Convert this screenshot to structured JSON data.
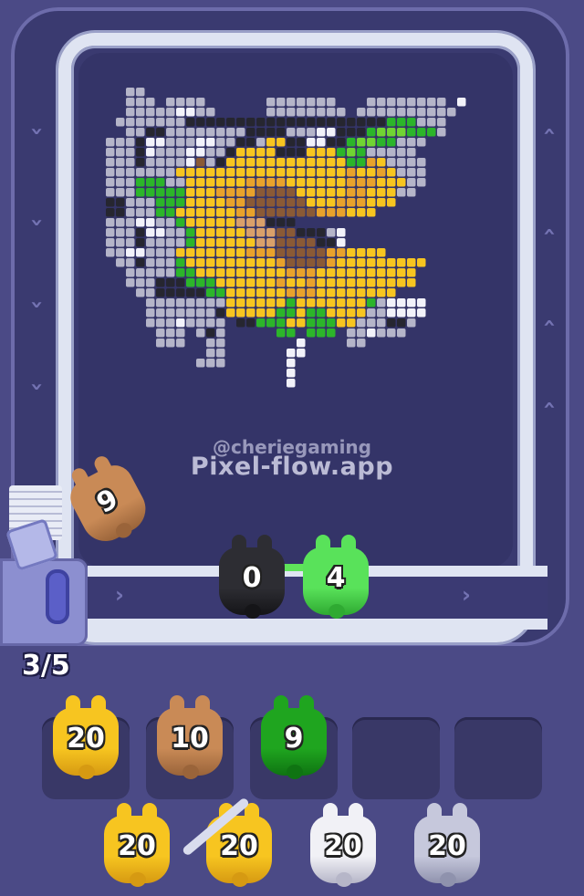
{
  "watermark": {
    "handle": "@cheriegaming",
    "site": "Pixel-flow.app"
  },
  "pixel_art": {
    "subject": "sunflower",
    "palette": {
      "W": "#f2f2fa",
      "G": "#b5b5c9",
      "D": "#262630",
      "Y": "#f7c520",
      "O": "#e8a22c",
      "B": "#8a5a36",
      "L": "#d9a06a",
      "V": "#2cb52a",
      "N": "#70d433"
    },
    "rows": [
      "..GG..............................",
      "..GGG.GGGG......GGGGGGG...GGGGGGGG.W",
      "..GGGGGWWGG.....GGGGGGGG.GGGGGGGGGG",
      ".GGGGGGGDDDDDDDDDDDDDDDDDDDDVVVGGG.",
      "..GGDDGGGGGGGGDDDDGGGWWDDDVNNNVVVG.",
      "GGGDWWGGGWWGGDDGYYDDWWDDVNNVVGGG.",
      "GGGDWGGGWWGGDYYYYDDDYYYVNVGGGGG..",
      "GGGDGGGGWBGDYYYYYYYYYYYYVVOYGGGG.",
      "GGGGGGGYYYYYYYYYYYYYYYYYOYYOYGGG",
      "GGGVVVGGYYYYYYOOOOYYYYYYOOOYYYGG",
      "GGGVVVVVYYYOOOOBBBBYYYYYOOYYYGG.",
      "DDGGGVVVYYYYOOBBBBBBYYYOOOYYY...",
      "DDGGGVVYYYYYYOOBBBBBBOOOYYY.....",
      "GGGWWGGVYYYYYLLLDDD.............",
      "GGGDWWGGVYYYYYLLLBBDDDGW........",
      "GGGDGGGGVYYYYYYLLBBBBDDW........",
      "GGWWGGGYYYYYYYOOOBBBBBOOYYYY....",
      ".GGDGGGVYYYYYYYYYOBBBBOYYYYYYYYY.",
      "..GGGGGVVYYYYYYYYYOOOYYYYYYYYYY..",
      "..GGGDDDVVVYYYYYYOYYOYYYYYYYYYY..",
      "...GGDDDDDVVYYYYYYOOOYYYYYYYY....",
      "....GGGGGGGGYYYYYYVYYYYYYYVGWWWW",
      "....GGGGGGGDYYYYYVVYVVYYYYGGWWWW",
      "....GGGWGGGG.DDVVVYYVVVYYGGGDDG.",
      ".....GGG.GDG.....VV.VVV.GGWGGG..",
      ".....GGG..GG.......W....GG......",
      "..........GG......WW............",
      ".........GGG......W.............",
      "..................W.............",
      "..................W............."
    ]
  },
  "conveyor_units": [
    {
      "number": "0",
      "color": "#2d2d33",
      "shade": "#151518"
    },
    {
      "number": "4",
      "color": "#59e25a",
      "shade": "#2faa32"
    }
  ],
  "launch_unit": {
    "number": "9",
    "color": "#c98a56",
    "shade": "#9a643a"
  },
  "capacity": {
    "text": "3/5"
  },
  "queue_slots": [
    {
      "number": "20",
      "color": "#f7c520",
      "shade": "#d69a12"
    },
    {
      "number": "10",
      "color": "#c98a56",
      "shade": "#9a643a"
    },
    {
      "number": "9",
      "color": "#1fa51f",
      "shade": "#0f7412"
    },
    {
      "number": "",
      "color": "",
      "shade": ""
    },
    {
      "number": "",
      "color": "",
      "shade": ""
    }
  ],
  "reserve_units": [
    {
      "number": "20",
      "color": "#f7c520",
      "shade": "#d69a12"
    },
    {
      "number": "20",
      "color": "#f7c520",
      "shade": "#d69a12"
    },
    {
      "number": "20",
      "color": "#f1f1f6",
      "shade": "#b6b6c8"
    },
    {
      "number": "20",
      "color": "#c6c8dc",
      "shade": "#8f92ad"
    }
  ]
}
